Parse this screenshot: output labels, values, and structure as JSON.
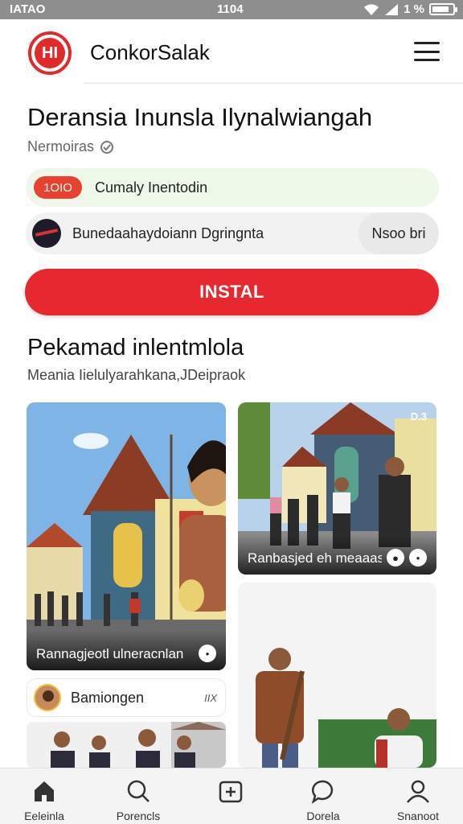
{
  "status_bar": {
    "carrier": "IATAO",
    "time": "1104",
    "battery": "1 %",
    "battery_level": 0.85
  },
  "header": {
    "app_name": "ConkorSalak",
    "logo_text": "HI",
    "logo_icon": "emblem-logo-icon",
    "menu_icon": "hamburger-menu-icon"
  },
  "title": "Deransia Inunsla Ilynalwiangah",
  "subtitle": "Nermoiras",
  "subtitle_icon": "verified-icon",
  "promo_row": {
    "badge": "1OIO",
    "text": "Cumaly Inentodin"
  },
  "dev_row": {
    "text": "Bunedaahaydoiann Dgringnta",
    "button": "Nsoo bri"
  },
  "install_label": "INSTAL",
  "section": {
    "title": "Pekamad inlentmlola",
    "subtitle": "Meania Iielulyarahkana,JDeipraok"
  },
  "cards": [
    {
      "caption": "Rannagjeotl ulneracnlan",
      "pin": "•"
    },
    {
      "caption": "Ranbasjed eh meaaasan",
      "tag": "D.3"
    },
    {
      "caption": ""
    }
  ],
  "author_card": {
    "name": "Bamiongen",
    "meta": "IIX"
  },
  "nav": [
    {
      "label": "Eeleinla",
      "icon": "home-icon"
    },
    {
      "label": "Porencls",
      "icon": "search-icon"
    },
    {
      "label": "",
      "icon": "add-square-icon"
    },
    {
      "label": "Dorela",
      "icon": "chat-bubble-icon"
    },
    {
      "label": "Snanoot",
      "icon": "profile-icon"
    }
  ],
  "colors": {
    "accent": "#e8282f",
    "status_bar": "#8e8e8e",
    "promo_bg": "#eef8e8"
  }
}
